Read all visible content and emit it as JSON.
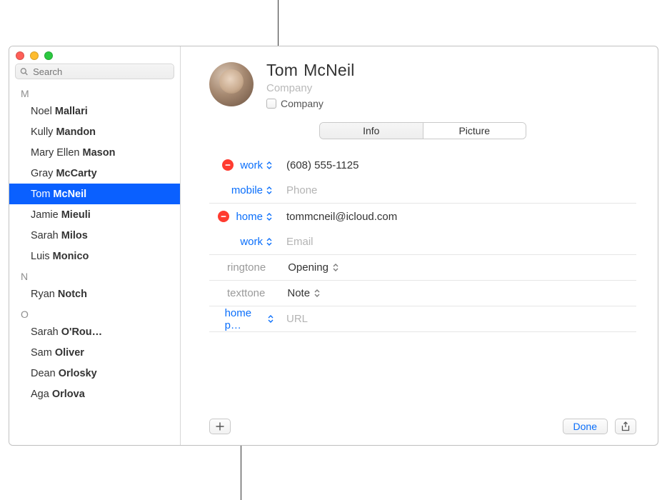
{
  "search": {
    "placeholder": "Search"
  },
  "sidebar": {
    "sections": [
      {
        "letter": "M",
        "items": [
          {
            "first": "Noel",
            "last": "Mallari",
            "selected": false
          },
          {
            "first": "Kully",
            "last": "Mandon",
            "selected": false
          },
          {
            "first": "Mary Ellen",
            "last": "Mason",
            "selected": false
          },
          {
            "first": "Gray",
            "last": "McCarty",
            "selected": false
          },
          {
            "first": "Tom",
            "last": "McNeil",
            "selected": true
          },
          {
            "first": "Jamie",
            "last": "Mieuli",
            "selected": false
          },
          {
            "first": "Sarah",
            "last": "Milos",
            "selected": false
          },
          {
            "first": "Luis",
            "last": "Monico",
            "selected": false
          }
        ]
      },
      {
        "letter": "N",
        "items": [
          {
            "first": "Ryan",
            "last": "Notch",
            "selected": false
          }
        ]
      },
      {
        "letter": "O",
        "items": [
          {
            "first": "Sarah",
            "last": "O'Rou…",
            "selected": false
          },
          {
            "first": "Sam",
            "last": "Oliver",
            "selected": false
          },
          {
            "first": "Dean",
            "last": "Orlosky",
            "selected": false
          },
          {
            "first": "Aga",
            "last": "Orlova",
            "selected": false
          }
        ]
      }
    ]
  },
  "card": {
    "first": "Tom",
    "last": "McNeil",
    "company_placeholder": "Company",
    "company_checkbox_label": "Company",
    "tabs": {
      "info": "Info",
      "picture": "Picture"
    },
    "fields": {
      "phone_work_label": "work",
      "phone_work_value": "(608) 555-1125",
      "phone_mobile_label": "mobile",
      "phone_mobile_placeholder": "Phone",
      "email_home_label": "home",
      "email_home_value": "tommcneil@icloud.com",
      "email_work_label": "work",
      "email_work_placeholder": "Email",
      "ringtone_label": "ringtone",
      "ringtone_value": "Opening",
      "texttone_label": "texttone",
      "texttone_value": "Note",
      "homepage_label": "home p…",
      "homepage_placeholder": "URL"
    },
    "done": "Done"
  },
  "colors": {
    "accent": "#0b6ffb",
    "remove": "#ff3b30"
  }
}
